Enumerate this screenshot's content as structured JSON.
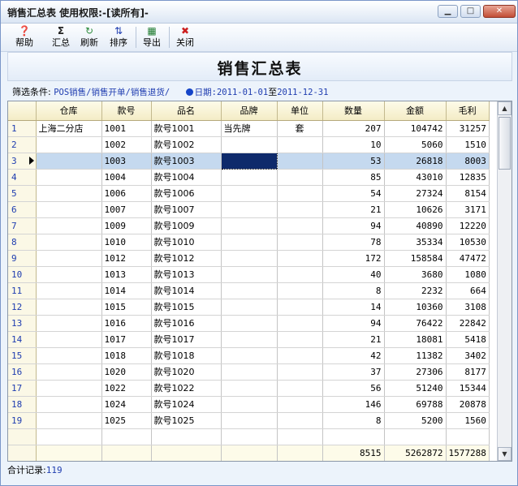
{
  "window": {
    "title": "销售汇总表  使用权限:-[读所有]-",
    "minimize_glyph": "▁",
    "maximize_glyph": "□",
    "close_glyph": "✕"
  },
  "toolbar": [
    {
      "label": "帮助",
      "icon": "help-icon",
      "glyph": "❓",
      "color": "#3a6fc4"
    },
    {
      "label": "汇总",
      "icon": "sigma-icon",
      "glyph": "Σ",
      "color": "#222222"
    },
    {
      "label": "刷新",
      "icon": "refresh-icon",
      "glyph": "↻",
      "color": "#2a8a3a"
    },
    {
      "label": "排序",
      "icon": "sort-icon",
      "glyph": "⇅",
      "color": "#1f3db0"
    },
    {
      "label": "导出",
      "icon": "excel-icon",
      "glyph": "▦",
      "color": "#1d7a2e"
    },
    {
      "label": "关闭",
      "icon": "close-icon",
      "glyph": "✖",
      "color": "#cc1f1f"
    }
  ],
  "report": {
    "title": "销售汇总表",
    "filter_label": "筛选条件:",
    "filter_value": "POS销售/销售开单/销售退货/",
    "date_label": "日期:",
    "date_from": "2011-01-01",
    "date_sep": "至",
    "date_to": "2011-12-31"
  },
  "table": {
    "columns": [
      "仓库",
      "款号",
      "品名",
      "品牌",
      "单位",
      "数量",
      "金额",
      "毛利"
    ],
    "selected_row": 3,
    "rows": [
      {
        "no": "1",
        "warehouse": "上海二分店",
        "code": "1001",
        "name": "款号1001",
        "brand": "当先牌",
        "unit": "套",
        "qty": "207",
        "amount": "104742",
        "profit": "31257"
      },
      {
        "no": "2",
        "warehouse": "",
        "code": "1002",
        "name": "款号1002",
        "brand": "",
        "unit": "",
        "qty": "10",
        "amount": "5060",
        "profit": "1510"
      },
      {
        "no": "3",
        "warehouse": "",
        "code": "1003",
        "name": "款号1003",
        "brand": "",
        "unit": "",
        "qty": "53",
        "amount": "26818",
        "profit": "8003"
      },
      {
        "no": "4",
        "warehouse": "",
        "code": "1004",
        "name": "款号1004",
        "brand": "",
        "unit": "",
        "qty": "85",
        "amount": "43010",
        "profit": "12835"
      },
      {
        "no": "5",
        "warehouse": "",
        "code": "1006",
        "name": "款号1006",
        "brand": "",
        "unit": "",
        "qty": "54",
        "amount": "27324",
        "profit": "8154"
      },
      {
        "no": "6",
        "warehouse": "",
        "code": "1007",
        "name": "款号1007",
        "brand": "",
        "unit": "",
        "qty": "21",
        "amount": "10626",
        "profit": "3171"
      },
      {
        "no": "7",
        "warehouse": "",
        "code": "1009",
        "name": "款号1009",
        "brand": "",
        "unit": "",
        "qty": "94",
        "amount": "40890",
        "profit": "12220"
      },
      {
        "no": "8",
        "warehouse": "",
        "code": "1010",
        "name": "款号1010",
        "brand": "",
        "unit": "",
        "qty": "78",
        "amount": "35334",
        "profit": "10530"
      },
      {
        "no": "9",
        "warehouse": "",
        "code": "1012",
        "name": "款号1012",
        "brand": "",
        "unit": "",
        "qty": "172",
        "amount": "158584",
        "profit": "47472"
      },
      {
        "no": "10",
        "warehouse": "",
        "code": "1013",
        "name": "款号1013",
        "brand": "",
        "unit": "",
        "qty": "40",
        "amount": "3680",
        "profit": "1080"
      },
      {
        "no": "11",
        "warehouse": "",
        "code": "1014",
        "name": "款号1014",
        "brand": "",
        "unit": "",
        "qty": "8",
        "amount": "2232",
        "profit": "664"
      },
      {
        "no": "12",
        "warehouse": "",
        "code": "1015",
        "name": "款号1015",
        "brand": "",
        "unit": "",
        "qty": "14",
        "amount": "10360",
        "profit": "3108"
      },
      {
        "no": "13",
        "warehouse": "",
        "code": "1016",
        "name": "款号1016",
        "brand": "",
        "unit": "",
        "qty": "94",
        "amount": "76422",
        "profit": "22842"
      },
      {
        "no": "14",
        "warehouse": "",
        "code": "1017",
        "name": "款号1017",
        "brand": "",
        "unit": "",
        "qty": "21",
        "amount": "18081",
        "profit": "5418"
      },
      {
        "no": "15",
        "warehouse": "",
        "code": "1018",
        "name": "款号1018",
        "brand": "",
        "unit": "",
        "qty": "42",
        "amount": "11382",
        "profit": "3402"
      },
      {
        "no": "16",
        "warehouse": "",
        "code": "1020",
        "name": "款号1020",
        "brand": "",
        "unit": "",
        "qty": "37",
        "amount": "27306",
        "profit": "8177"
      },
      {
        "no": "17",
        "warehouse": "",
        "code": "1022",
        "name": "款号1022",
        "brand": "",
        "unit": "",
        "qty": "56",
        "amount": "51240",
        "profit": "15344"
      },
      {
        "no": "18",
        "warehouse": "",
        "code": "1024",
        "name": "款号1024",
        "brand": "",
        "unit": "",
        "qty": "146",
        "amount": "69788",
        "profit": "20878"
      },
      {
        "no": "19",
        "warehouse": "",
        "code": "1025",
        "name": "款号1025",
        "brand": "",
        "unit": "",
        "qty": "8",
        "amount": "5200",
        "profit": "1560"
      }
    ],
    "totals": {
      "qty": "8515",
      "amount": "5262872",
      "profit": "1577288"
    }
  },
  "scrollbar": {
    "up_glyph": "▲",
    "down_glyph": "▼"
  },
  "status": {
    "label": "合计记录:",
    "count": "119"
  },
  "colors": {
    "selection": "#c5d9ef",
    "active_cell": "#0e2a6b",
    "link_blue": "#1f3db0",
    "header_bg": "#f4ecc6"
  }
}
